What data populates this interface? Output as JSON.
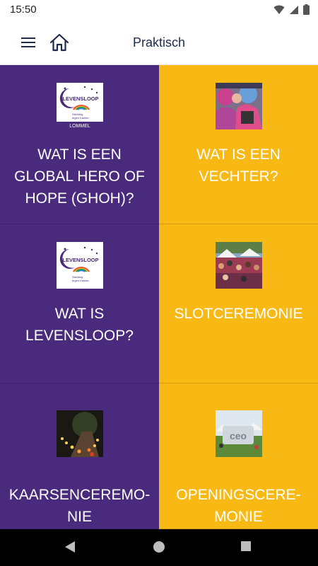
{
  "status_bar": {
    "time": "15:50",
    "icons": [
      "wifi-icon",
      "signal-icon",
      "battery-icon"
    ]
  },
  "app_bar": {
    "title": "Praktisch",
    "menu_icon": "menu-icon",
    "home_icon": "home-icon"
  },
  "tiles": [
    {
      "label": "WAT IS EEN\nGLOBAL HERO OF\nHOPE (GHOH)?",
      "color": "#4a2a7c",
      "image": "levensloop-logo-lommel",
      "logo_text": "LEVENSLOOP",
      "logo_sub": "Stichting\ntegen Kanker",
      "logo_footer": "LOMMEL"
    },
    {
      "label": "WAT IS EEN\nVECHTER?",
      "color": "#f9b915",
      "image": "fighters-photo"
    },
    {
      "label": "WAT IS\nLEVENSLOOP?",
      "color": "#4a2a7c",
      "image": "levensloop-logo",
      "logo_text": "LEVENSLOOP",
      "logo_sub": "Stichting\ntegen Kanker"
    },
    {
      "label": "SLOTCEREMONIE",
      "color": "#f9b915",
      "image": "event-crowd-photo"
    },
    {
      "label": "KAARSENCEREMO-\nNIE",
      "color": "#4a2a7c",
      "image": "candles-photo"
    },
    {
      "label": "OPENINGSCERE-\nMONIE",
      "color": "#f9b915",
      "image": "opening-photo"
    }
  ],
  "nav_bar": {
    "back_icon": "back-icon",
    "home_icon": "home-circle-icon",
    "recents_icon": "recents-icon"
  }
}
